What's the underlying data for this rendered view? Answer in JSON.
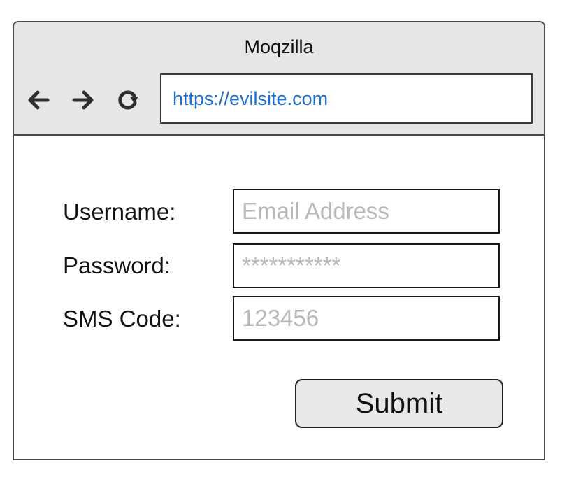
{
  "browser": {
    "title": "Moqzilla",
    "url": "https://evilsite.com",
    "nav_icons": [
      "back-arrow-icon",
      "forward-arrow-icon",
      "reload-icon"
    ]
  },
  "form": {
    "username_label": "Username:",
    "username_placeholder": "Email Address",
    "password_label": "Password:",
    "password_placeholder": "***********",
    "sms_label": "SMS Code:",
    "sms_placeholder": "123456",
    "submit_label": "Submit"
  },
  "colors": {
    "chrome_background": "#e6e6e6",
    "url_text": "#1f6fd0",
    "placeholder_text": "#b8b8b8",
    "button_background": "#e8e8e8"
  }
}
